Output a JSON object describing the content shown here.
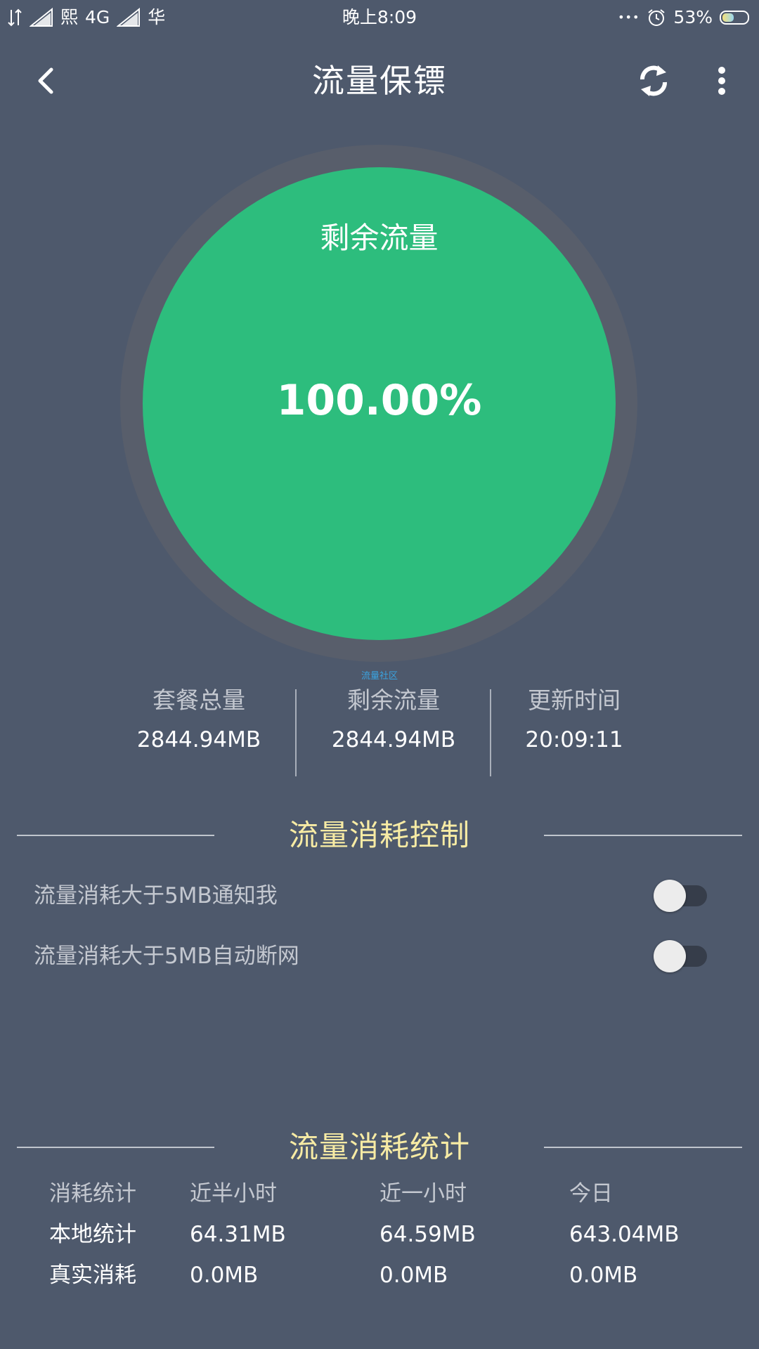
{
  "status_bar": {
    "carrier1": "熙",
    "network": "4G",
    "carrier2": "华",
    "time": "晚上8:09",
    "dots": "•••",
    "battery_percent": "53%",
    "battery_level": 0.53
  },
  "toolbar": {
    "title": "流量保镖",
    "icons": {
      "back": "chevron-left-icon",
      "refresh": "refresh-icon",
      "more": "more-vertical-icon"
    }
  },
  "gauge": {
    "label": "剩余流量",
    "value": "100.00%",
    "percent": 100,
    "fill_color": "#2dbd7d",
    "ring_color": "#585e6b"
  },
  "watermark": "流量社区",
  "stats": [
    {
      "label": "套餐总量",
      "value": "2844.94MB"
    },
    {
      "label": "剩余流量",
      "value": "2844.94MB"
    },
    {
      "label": "更新时间",
      "value": "20:09:11"
    }
  ],
  "control": {
    "title": "流量消耗控制",
    "items": [
      {
        "label": "流量消耗大于5MB通知我",
        "enabled": false
      },
      {
        "label": "流量消耗大于5MB自动断网",
        "enabled": false
      }
    ]
  },
  "statistics": {
    "title": "流量消耗统计",
    "headers": [
      "消耗统计",
      "近半小时",
      "近一小时",
      "今日"
    ],
    "rows": [
      [
        "本地统计",
        "64.31MB",
        "64.59MB",
        "643.04MB"
      ],
      [
        "真实消耗",
        "0.0MB",
        "0.0MB",
        "0.0MB"
      ]
    ]
  },
  "colors": {
    "background": "#4e596c",
    "accent_title": "#f7eba4",
    "gauge_green": "#2dbd7d",
    "muted_text": "#c4c8d0"
  }
}
